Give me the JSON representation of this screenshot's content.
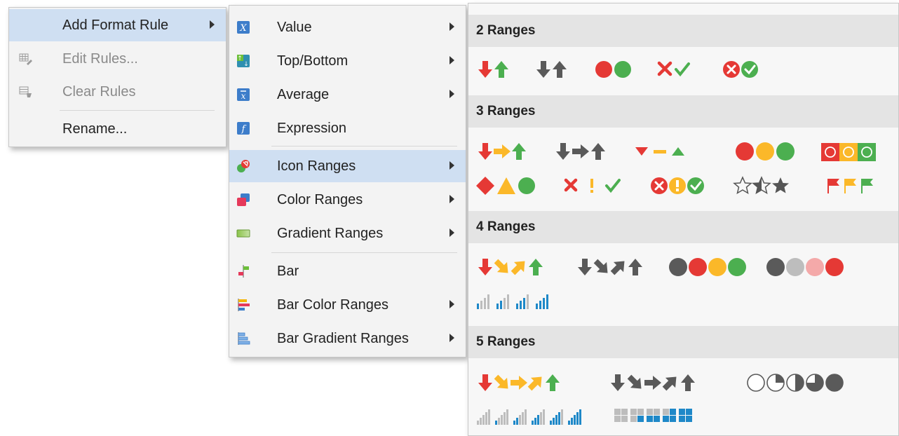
{
  "menu_main": {
    "items": [
      {
        "label": "Add Format Rule",
        "has_submenu": true,
        "highlighted": true,
        "disabled": false
      },
      {
        "label": "Edit Rules...",
        "has_submenu": false,
        "highlighted": false,
        "disabled": true
      },
      {
        "label": "Clear Rules",
        "has_submenu": false,
        "highlighted": false,
        "disabled": true
      },
      {
        "label": "Rename...",
        "has_submenu": false,
        "highlighted": false,
        "disabled": false
      }
    ]
  },
  "menu_rules": {
    "items": [
      {
        "label": "Value",
        "icon": "value-icon",
        "has_submenu": true
      },
      {
        "label": "Top/Bottom",
        "icon": "top-bottom-icon",
        "has_submenu": true
      },
      {
        "label": "Average",
        "icon": "average-icon",
        "has_submenu": true
      },
      {
        "label": "Expression",
        "icon": "expression-icon",
        "has_submenu": false
      },
      {
        "label": "Icon Ranges",
        "icon": "icon-ranges-icon",
        "has_submenu": true,
        "highlighted": true
      },
      {
        "label": "Color Ranges",
        "icon": "color-ranges-icon",
        "has_submenu": true
      },
      {
        "label": "Gradient Ranges",
        "icon": "gradient-ranges-icon",
        "has_submenu": true
      },
      {
        "label": "Bar",
        "icon": "bar-icon",
        "has_submenu": false
      },
      {
        "label": "Bar Color Ranges",
        "icon": "bar-color-ranges-icon",
        "has_submenu": true
      },
      {
        "label": "Bar Gradient Ranges",
        "icon": "bar-gradient-ranges-icon",
        "has_submenu": true
      }
    ]
  },
  "gallery": {
    "groups": [
      {
        "title": "2 Ranges",
        "icon_sets": [
          "arrows-colored",
          "arrows-gray",
          "circles-red-green",
          "symbols-uncircled",
          "symbols-circled"
        ]
      },
      {
        "title": "3 Ranges",
        "icon_sets": [
          "arrows-colored",
          "arrows-gray",
          "triangles",
          "traffic-lights",
          "boxes",
          "signs",
          "symbols-uncircled",
          "symbols-circled",
          "stars",
          "flags"
        ]
      },
      {
        "title": "4 Ranges",
        "icon_sets": [
          "arrows-colored",
          "arrows-gray",
          "traffic-lights",
          "red-to-black",
          "bars"
        ]
      },
      {
        "title": "5 Ranges",
        "icon_sets": [
          "arrows-colored",
          "arrows-gray",
          "quarters",
          "bars",
          "boxes"
        ]
      }
    ]
  },
  "colors": {
    "red": "#e53935",
    "green": "#4caf50",
    "yellow": "#fbb829",
    "gray": "#5a5a5a",
    "blue": "#1e88c8",
    "highlight": "#cfdff2"
  }
}
